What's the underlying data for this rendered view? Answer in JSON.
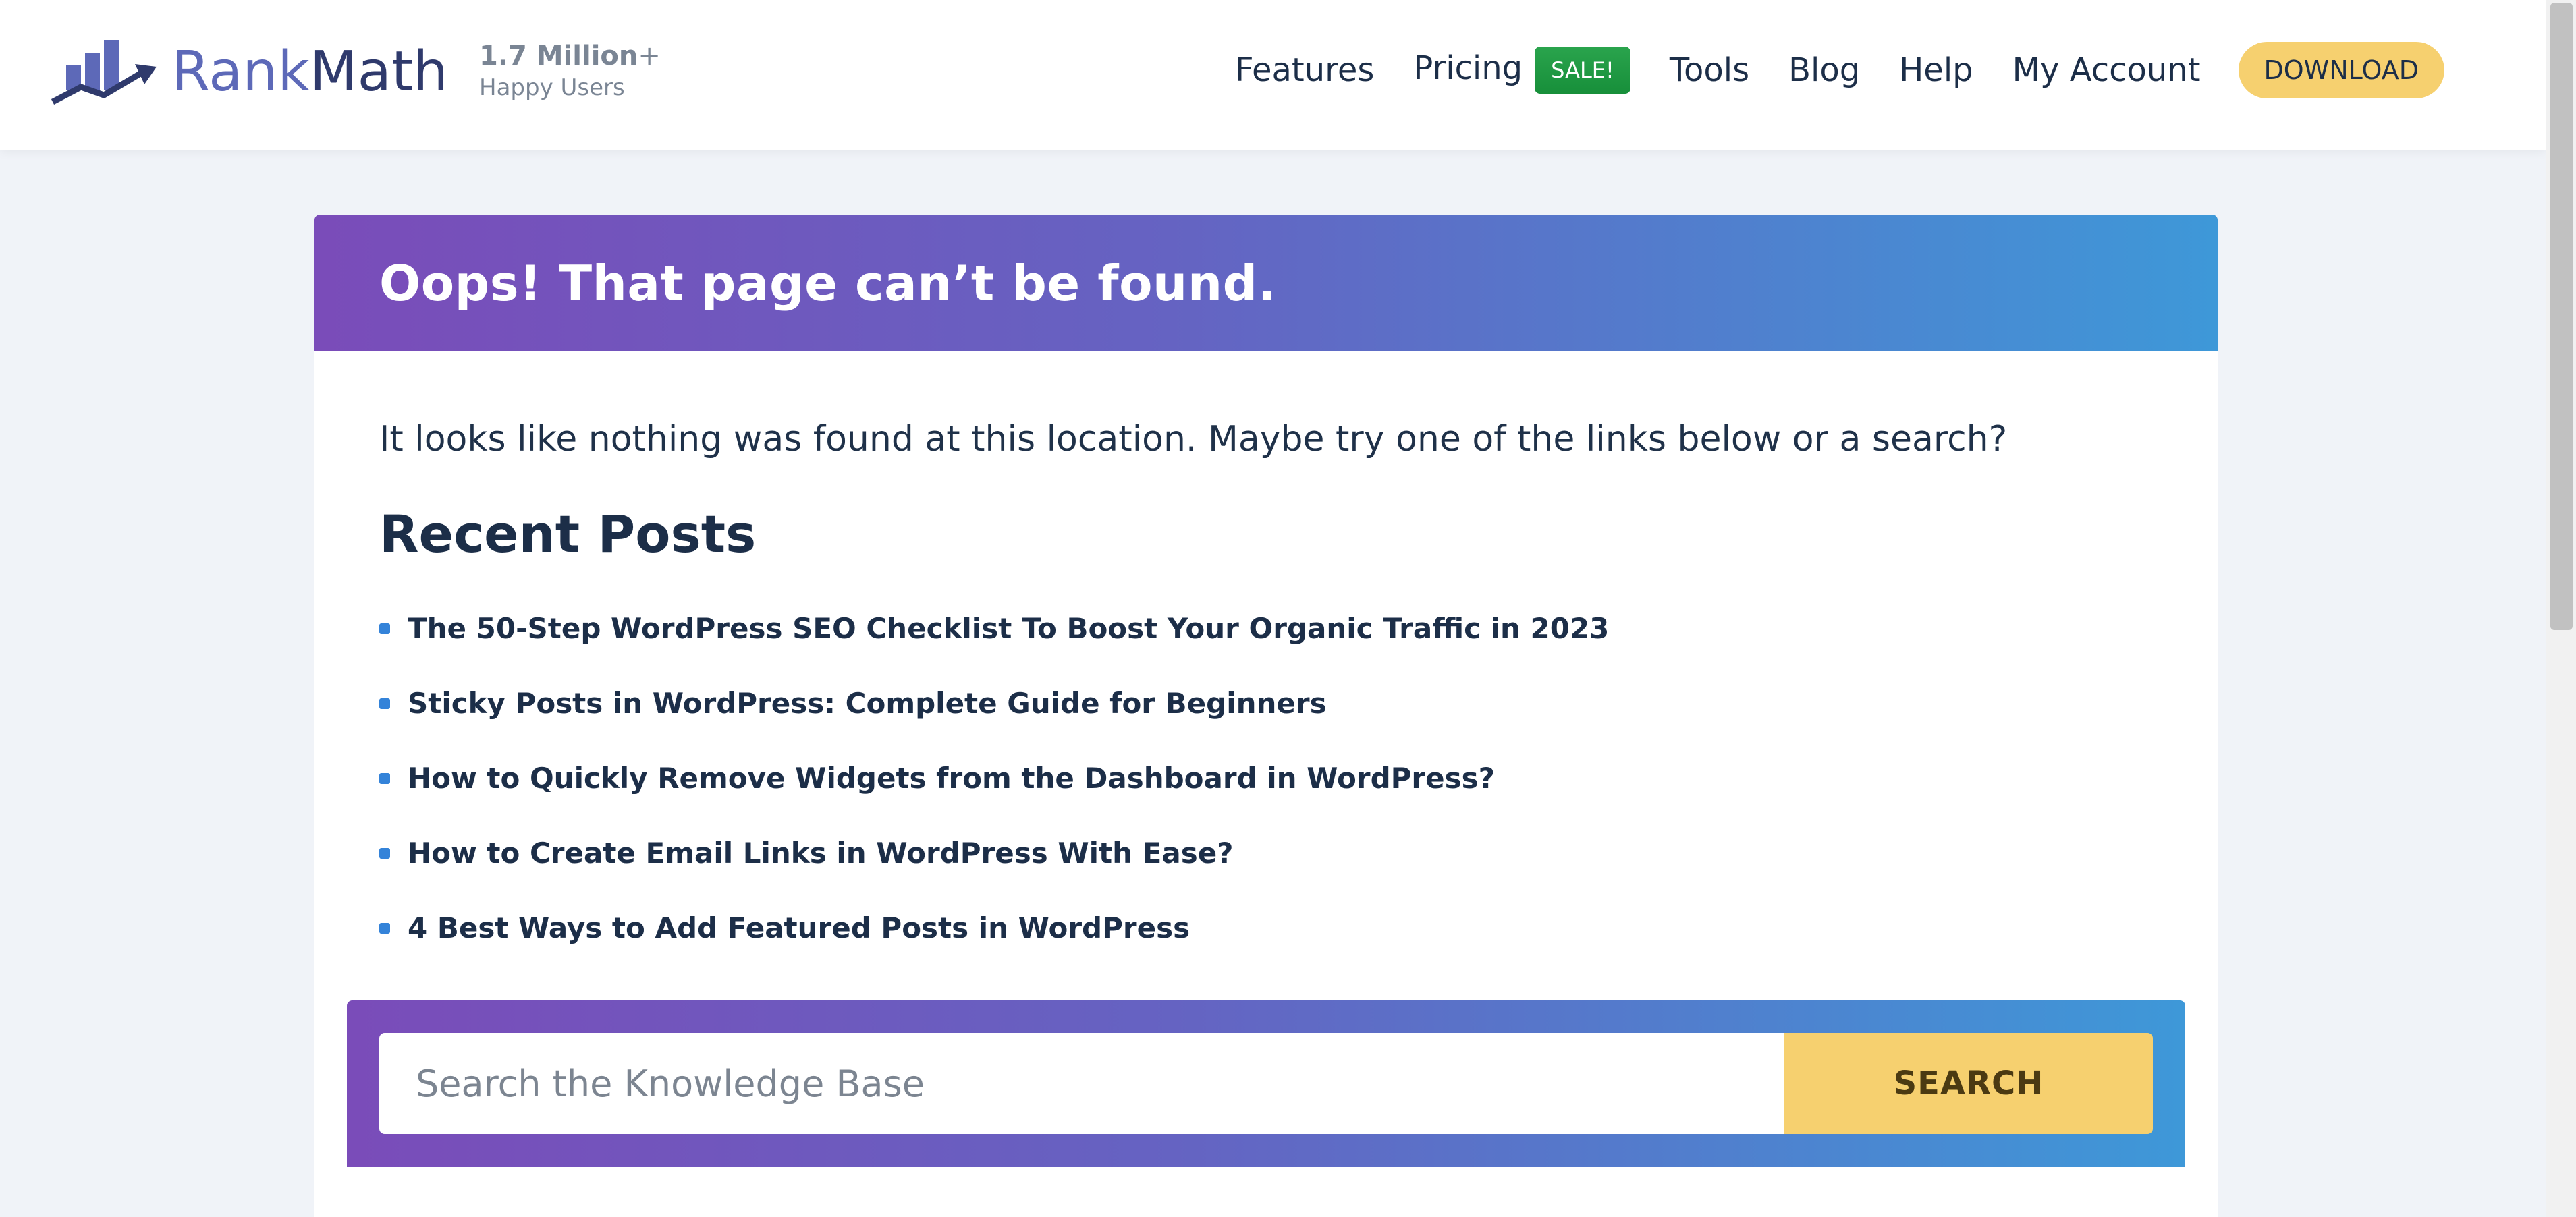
{
  "header": {
    "brand_rank": "Rank",
    "brand_math": "Math",
    "users_count": "1.7 Million",
    "users_plus": "+",
    "users_label": "Happy Users",
    "nav": {
      "features": "Features",
      "pricing": "Pricing",
      "sale": "SALE!",
      "tools": "Tools",
      "blog": "Blog",
      "help": "Help",
      "account": "My Account",
      "download": "DOWNLOAD"
    }
  },
  "main": {
    "title": "Oops! That page can’t be found.",
    "message": "It looks like nothing was found at this location. Maybe try one of the links below or a search?",
    "recent_title": "Recent Posts",
    "posts": [
      "The 50-Step WordPress SEO Checklist To Boost Your Organic Traffic in 2023",
      "Sticky Posts in WordPress: Complete Guide for Beginners",
      "How to Quickly Remove Widgets from the Dashboard in WordPress?",
      "How to Create Email Links in WordPress With Ease?",
      "4 Best Ways to Add Featured Posts in WordPress"
    ],
    "search": {
      "placeholder": "Search the Knowledge Base",
      "value": "",
      "button": "SEARCH"
    }
  },
  "icons": {
    "logo": "rankmath-logo-icon",
    "bullet": "square-bullet-icon"
  },
  "colors": {
    "brand_purple": "#5d69b8",
    "gradient_start": "#7a4cb9",
    "gradient_end": "#3e98d8",
    "sale_green": "#1f9a43",
    "accent_yellow": "#f6d06f",
    "bullet_blue": "#3483d9",
    "text_dark": "#1c2e48"
  }
}
